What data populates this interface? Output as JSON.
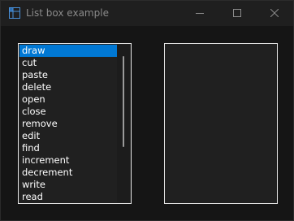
{
  "window": {
    "title": "List box example",
    "icon": "app-grid-icon",
    "controls": [
      "minimize-icon",
      "maximize-icon",
      "close-icon"
    ],
    "accent_color": "#0078d4"
  },
  "left_list": {
    "items": [
      "draw",
      "cut",
      "paste",
      "delete",
      "open",
      "close",
      "remove",
      "edit",
      "find",
      "increment",
      "decrement",
      "write",
      "read"
    ],
    "selected_index": 0
  },
  "right_list": {
    "items": []
  }
}
